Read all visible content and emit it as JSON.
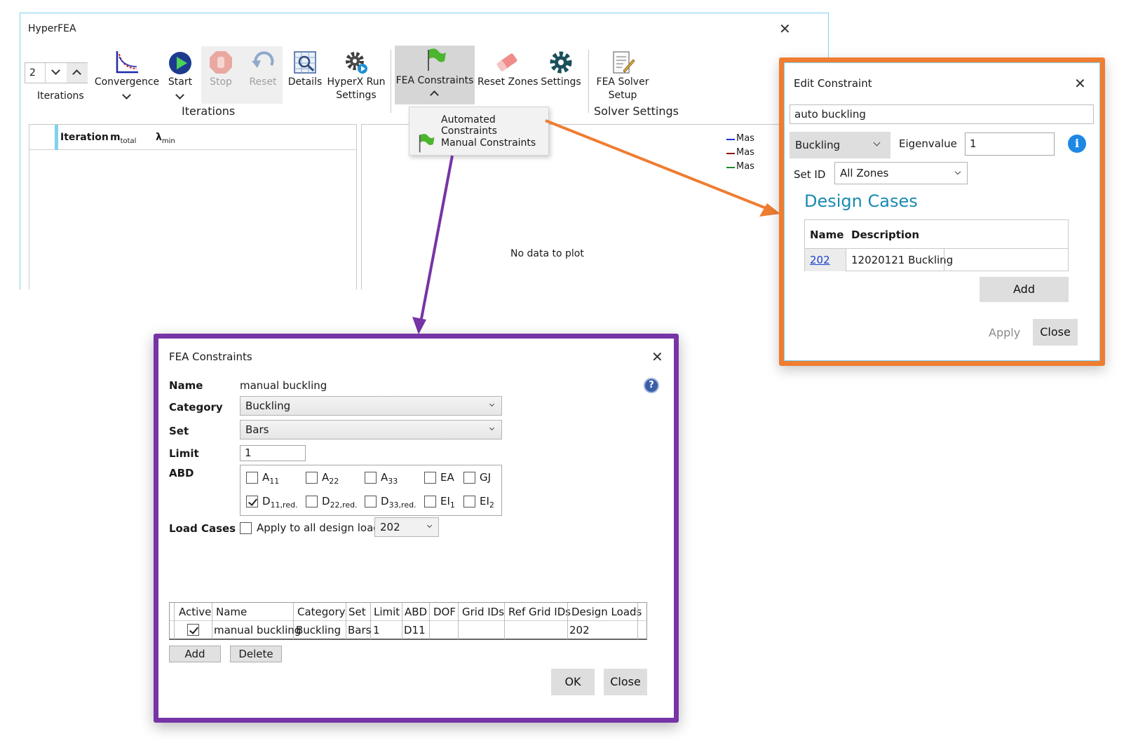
{
  "main_window": {
    "title": "HyperFEA",
    "iterations_spin": {
      "value": "2",
      "label": "Iterations"
    },
    "toolbar": {
      "convergence": "Convergence",
      "start": "Start",
      "stop": "Stop",
      "reset": "Reset",
      "details": "Details",
      "hyperx_run_settings_1": "HyperX Run",
      "hyperx_run_settings_2": "Settings",
      "fea_constraints": "FEA Constraints",
      "reset_zones": "Reset Zones",
      "settings": "Settings",
      "fea_solver_setup_1": "FEA Solver",
      "fea_solver_setup_2": "Setup"
    },
    "groups": {
      "iterations": "Iterations",
      "solver_settings": "Solver Settings"
    },
    "dropdown_menu": {
      "automated": "Automated Constraints",
      "manual": "Manual Constraints"
    },
    "grid_headers": {
      "iteration": "Iteration",
      "mtotal_base": "m",
      "mtotal_sub": "total",
      "lambda_base": "λ",
      "lambda_sub": "min"
    },
    "plot": {
      "empty_text": "No data to plot",
      "legend": [
        "Mas",
        "Mas",
        "Mas"
      ]
    },
    "colors": {
      "legend": [
        "#1f2fd6",
        "#8b1a1a",
        "#1f8a2a"
      ]
    }
  },
  "edit_constraint": {
    "title": "Edit Constraint",
    "name_value": "auto buckling",
    "type_value": "Buckling",
    "eigenvalue_label": "Eigenvalue",
    "eigenvalue_value": "1",
    "set_id_label": "Set ID",
    "set_id_value": "All Zones",
    "design_cases_title": "Design Cases",
    "table_headers": {
      "name": "Name",
      "description": "Description"
    },
    "rows": [
      {
        "name": "202",
        "description": "12020121 Buckling"
      }
    ],
    "add": "Add",
    "apply": "Apply",
    "close": "Close",
    "frame_color": "#ef7d32"
  },
  "fea_constraints": {
    "title": "FEA Constraints",
    "labels": {
      "name": "Name",
      "category": "Category",
      "set": "Set",
      "limit": "Limit",
      "abd": "ABD",
      "load_cases": "Load Cases"
    },
    "name_value": "manual buckling",
    "category_value": "Buckling",
    "set_value": "Bars",
    "limit_value": "1",
    "abd_items": [
      {
        "base": "A",
        "sub": "11",
        "checked": false
      },
      {
        "base": "A",
        "sub": "22",
        "checked": false
      },
      {
        "base": "A",
        "sub": "33",
        "checked": false
      },
      {
        "base": "EA",
        "sub": "",
        "checked": false
      },
      {
        "base": "GJ",
        "sub": "",
        "checked": false
      },
      {
        "base": "D",
        "sub": "11,red.",
        "checked": true
      },
      {
        "base": "D",
        "sub": "22,red.",
        "checked": false
      },
      {
        "base": "D",
        "sub": "33,red.",
        "checked": false
      },
      {
        "base": "EI",
        "sub": "1",
        "checked": false
      },
      {
        "base": "EI",
        "sub": "2",
        "checked": false
      }
    ],
    "apply_all_label": "Apply to all design loads",
    "load_case_value": "202",
    "grid_headers": [
      "Active",
      "Name",
      "Category",
      "Set",
      "Limit",
      "ABD",
      "DOF",
      "Grid IDs",
      "Ref Grid IDs",
      "Design Loads"
    ],
    "grid_row": {
      "active": true,
      "name": "manual buckling",
      "category": "Buckling",
      "set": "Bars",
      "limit": "1",
      "abd": "D11",
      "dof": "",
      "grid_ids": "",
      "ref_grid_ids": "",
      "design_loads": "202"
    },
    "add": "Add",
    "delete": "Delete",
    "ok": "OK",
    "close": "Close",
    "frame_color": "#7634a6"
  }
}
